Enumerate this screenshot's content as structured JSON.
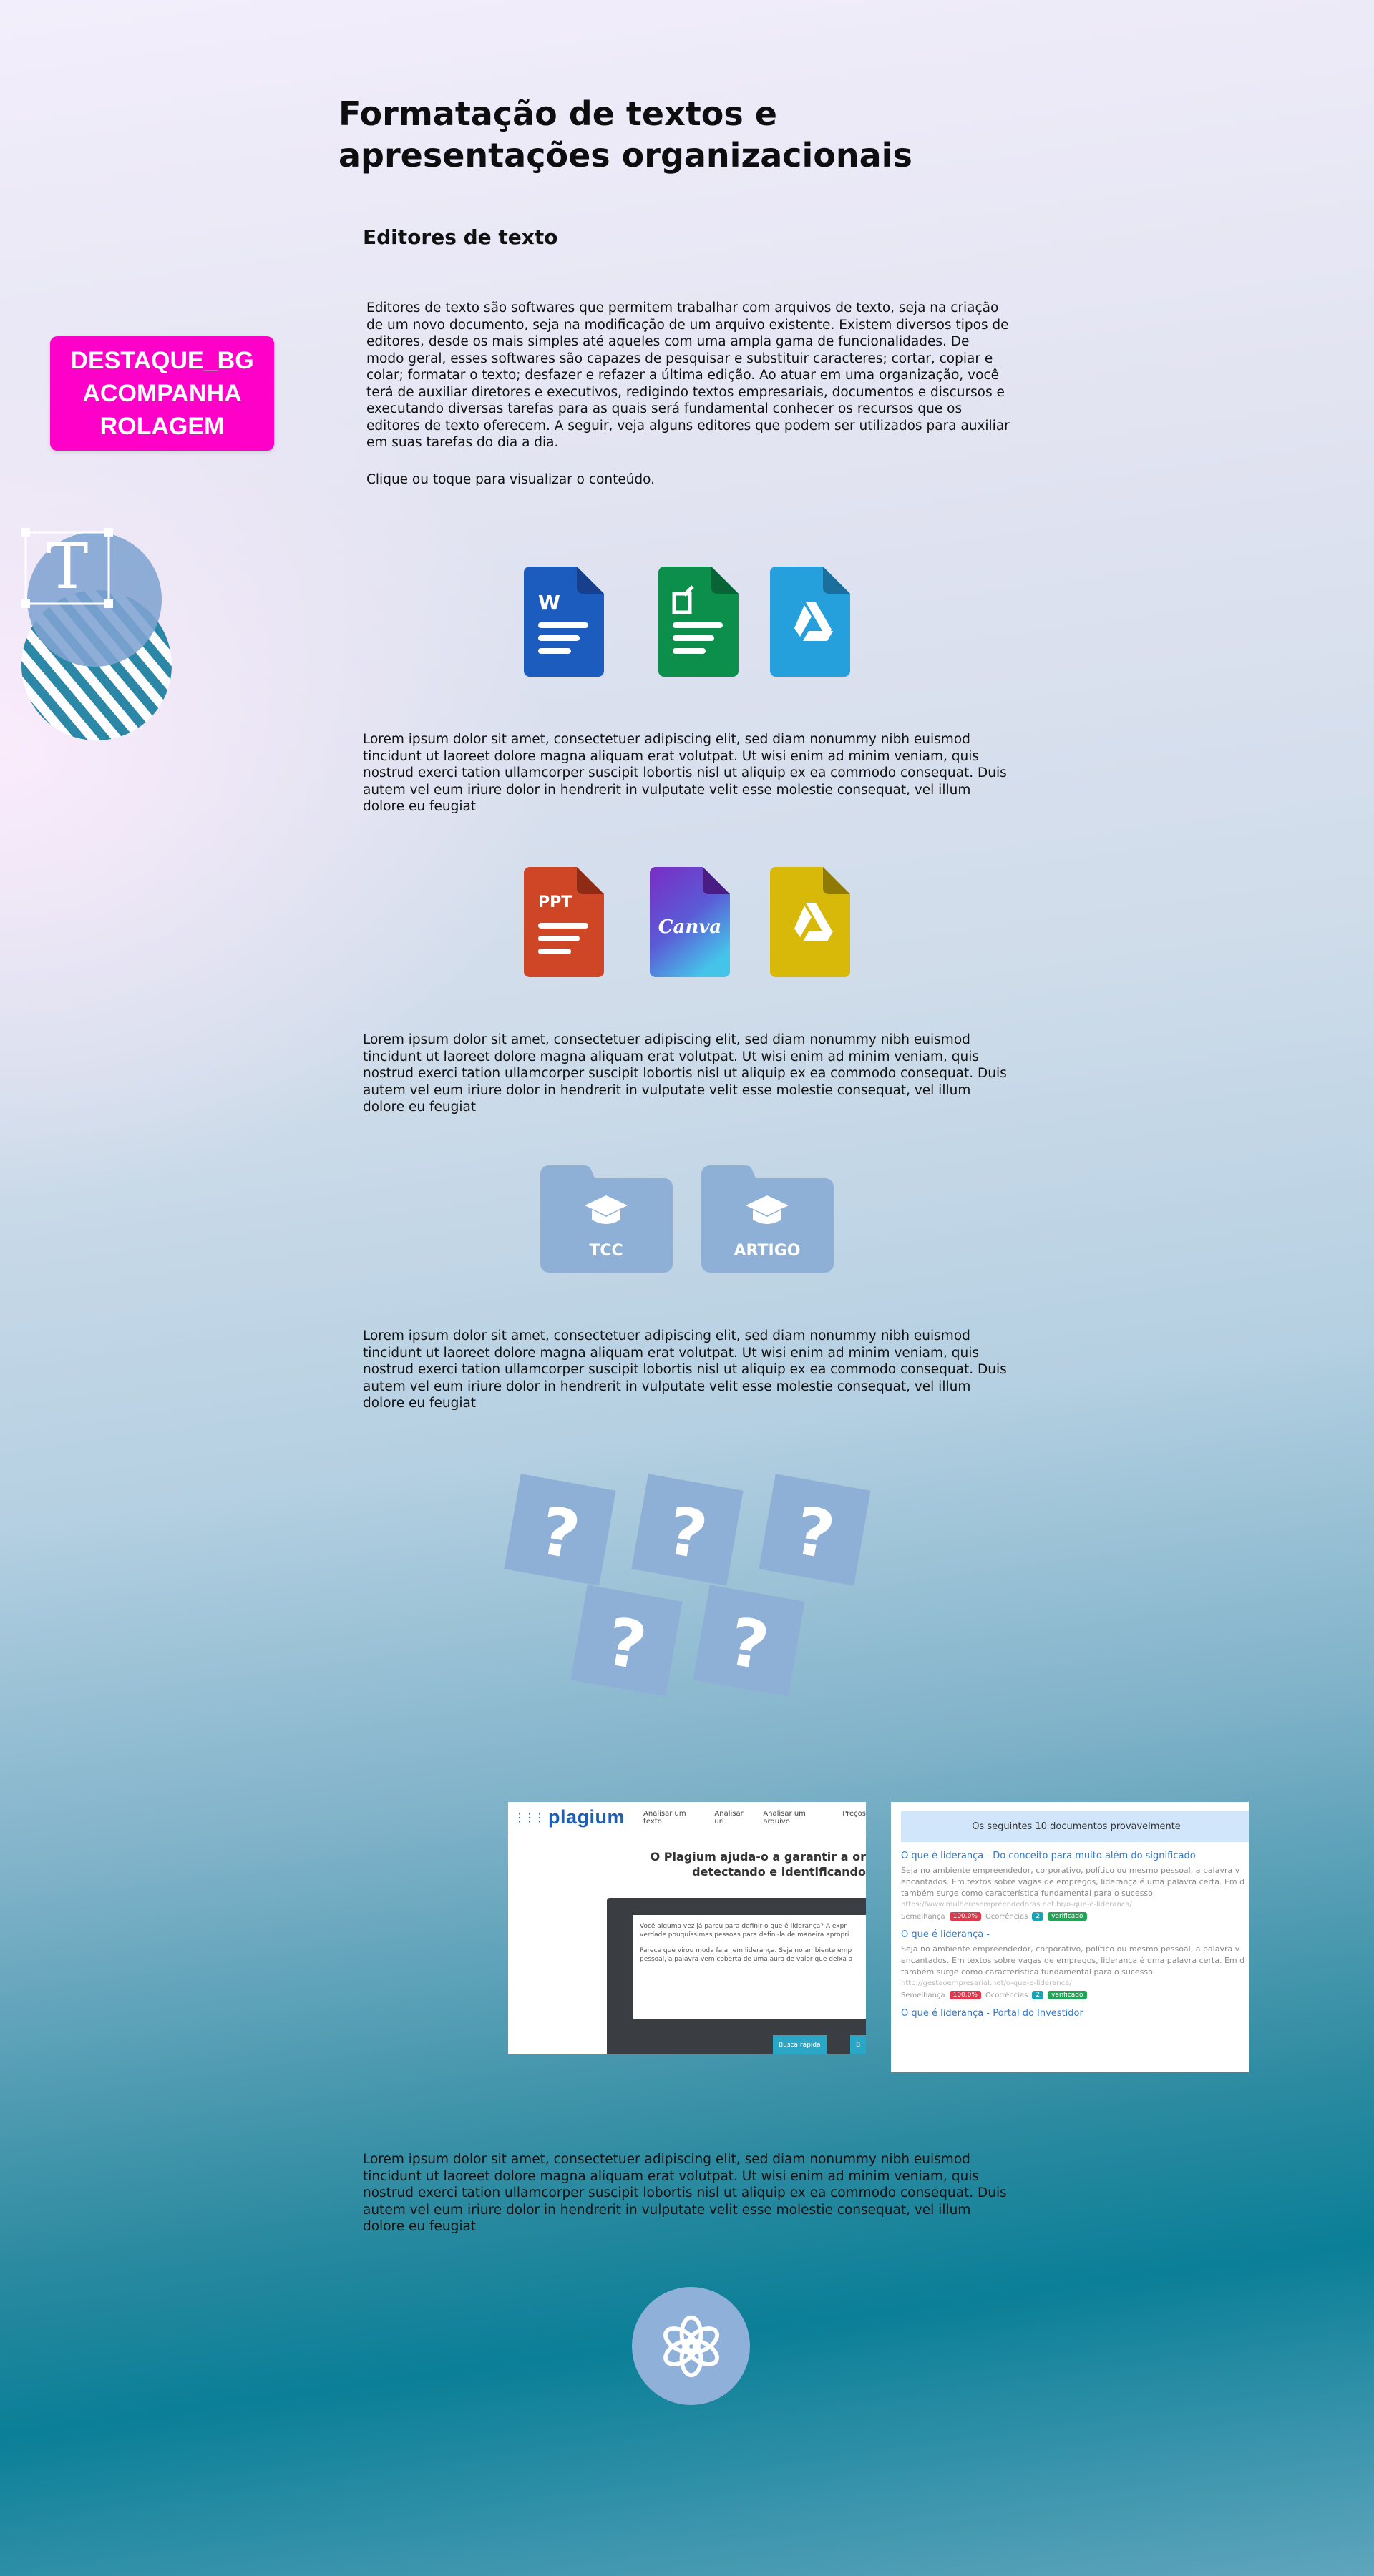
{
  "page": {
    "title": "Formatação de textos e apresentações organizacionais",
    "subtitle": "Editores de texto",
    "intro": "Editores de texto são softwares que permitem trabalhar com arquivos de texto, seja na criação de um novo documento, seja na modificação de um arquivo existente. Existem diversos tipos de editores, desde os mais simples até aqueles com uma ampla gama de funcionalidades. De modo geral, esses softwares são capazes de pesquisar e substituir caracteres; cortar, copiar e colar; formatar o texto; desfazer e refazer a última edição. Ao atuar em uma organização, você terá de auxiliar diretores e executivos, redigindo textos empresariais, documentos e discursos e executando diversas tarefas para as quais será fundamental conhecer os recursos que os editores de texto oferecem. A seguir, veja alguns editores que podem ser utilizados para auxiliar em suas tarefas do dia a dia.",
    "hint": "Clique ou toque para visualizar o conteúdo.",
    "lorem": "Lorem ipsum dolor sit amet, consectetuer adipiscing elit, sed diam nonummy nibh euismod tincidunt ut laoreet dolore magna aliquam erat volutpat. Ut wisi enim ad minim veniam, quis nostrud exerci tation ullamcorper suscipit lobortis nisl ut aliquip ex ea commodo consequat. Duis autem vel eum iriure dolor in hendrerit in vulputate velit esse molestie consequat, vel illum dolore eu feugiat"
  },
  "badge": {
    "line1": "DESTAQUE_BG",
    "line2": "ACOMPANHA",
    "line3": "ROLAGEM"
  },
  "icons": {
    "word": "W",
    "ppt": "PPT",
    "canva": "Canva",
    "folder_tcc": "TCC",
    "folder_artigo": "ARTIGO",
    "question": "?"
  },
  "colors": {
    "word": "#1d5cbf",
    "sheets": "#0c8f4b",
    "drive_blue": "#25a0dc",
    "ppt": "#cf4626",
    "canva_top": "#7a2cc4",
    "canva_bottom": "#45c4ea",
    "drive_yellow": "#d8b808",
    "folder": "#8fb0d6",
    "badge": "#ff00c8"
  },
  "plagium": {
    "logo": "plagium",
    "nav": [
      "Analisar um texto",
      "Analisar url",
      "Analisar um arquivo",
      "Preços"
    ],
    "headline1": "O Plagium ajuda-o a garantir a or",
    "headline2": "detectando e identificando",
    "editor_text1": "Você alguma vez já parou para definir o que é liderança? A expr verdade pouquíssimas pessoas para defini-la de maneira apropri",
    "editor_text2": "Parece que virou moda falar em liderança. Seja no ambiente emp pessoal, a palavra vem coberta de uma aura de valor que deixa a",
    "btn1": "Busca rápida",
    "btn2": "B"
  },
  "results": {
    "header": "Os seguintes 10 documentos provavelmente",
    "items": [
      {
        "title": "O que é liderança - Do conceito para muito além do significado",
        "text": "Seja no ambiente empreendedor, corporativo, político ou mesmo pessoal, a palavra v encantados. Em textos sobre vagas de empregos, liderança é uma palavra certa. Em d também surge como característica fundamental para o sucesso.",
        "url": "https://www.mulheresempreendedoras.net.br/o-que-e-lideranca/",
        "label_sim": "Semelhança",
        "sim": "100.0%",
        "label_occ": "Ocorrências",
        "occ": "2",
        "status": "verificado"
      },
      {
        "title": "O que é liderança -",
        "text": "Seja no ambiente empreendedor, corporativo, político ou mesmo pessoal, a palavra v encantados. Em textos sobre vagas de empregos, liderança é uma palavra certa. Em d também surge como característica fundamental para o sucesso.",
        "url": "http://gestaoempresarial.net/o-que-e-lideranca/",
        "label_sim": "Semelhança",
        "sim": "100.0%",
        "label_occ": "Ocorrências",
        "occ": "2",
        "status": "verificado"
      },
      {
        "title": "O que é liderança - Portal do Investidor",
        "text": "",
        "url": "",
        "label_sim": "",
        "sim": "",
        "label_occ": "",
        "occ": "",
        "status": ""
      }
    ]
  }
}
